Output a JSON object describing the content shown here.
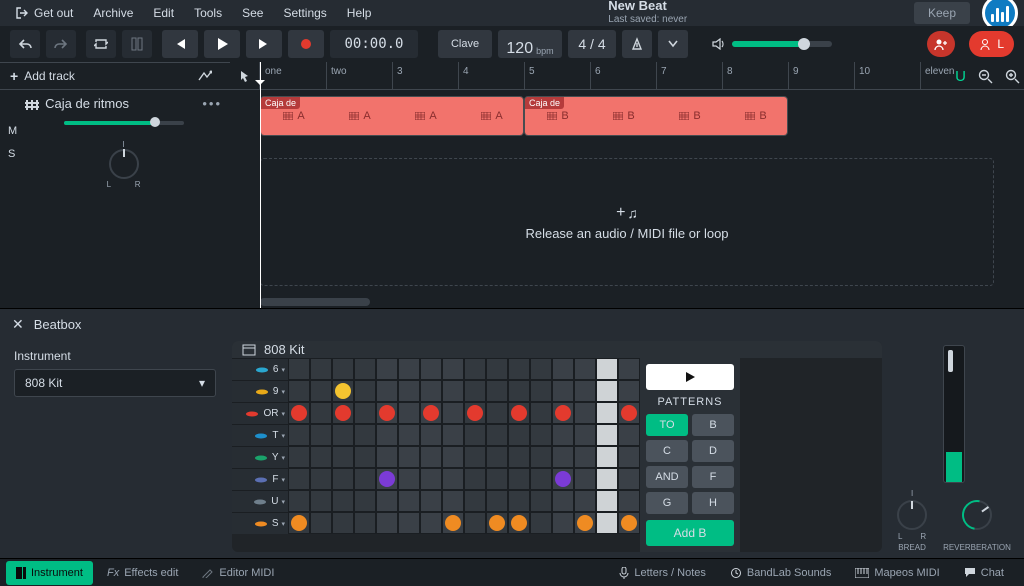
{
  "menu": {
    "getout": "Get out",
    "items": [
      "Archive",
      "Edit",
      "Tools",
      "See",
      "Settings",
      "Help"
    ],
    "keep": "Keep"
  },
  "title": {
    "name": "New Beat",
    "saved": "Last saved: never"
  },
  "transport": {
    "time": "00:00.0",
    "clave": "Clave",
    "bpm": "120",
    "bpm_unit": "bpm",
    "timesig": "4 / 4"
  },
  "collab": {
    "label": "L"
  },
  "sidebar": {
    "add": "Add track"
  },
  "track": {
    "name": "Caja de ritmos",
    "mute": "M",
    "solo": "S",
    "pan_i": "I",
    "pan_l": "L",
    "pan_r": "R"
  },
  "ruler": [
    "one",
    "two",
    "3",
    "4",
    "5",
    "6",
    "7",
    "8",
    "9",
    "10",
    "eleven"
  ],
  "clipA": {
    "tag": "Caja de",
    "segs": [
      "A",
      "A",
      "A",
      "A"
    ]
  },
  "clipB": {
    "tag": "Caja de",
    "segs": [
      "B",
      "B",
      "B",
      "B"
    ]
  },
  "drop": "Release an audio / MIDI file or loop",
  "zoom": {
    "magnet": "U"
  },
  "beatbox": {
    "title": "Beatbox",
    "instrument_label": "Instrument",
    "instrument": "808 Kit",
    "kit": "808 Kit",
    "rows": [
      {
        "id": "6",
        "color": "#2aa7d0",
        "steps": []
      },
      {
        "id": "9",
        "color": "#e8a918",
        "steps": [
          {
            "i": 2,
            "c": "#f4c430"
          }
        ]
      },
      {
        "id": "OR",
        "color": "#e33a2e",
        "steps": [
          {
            "i": 0,
            "c": "#e33a2e"
          },
          {
            "i": 2,
            "c": "#e33a2e"
          },
          {
            "i": 4,
            "c": "#e33a2e"
          },
          {
            "i": 6,
            "c": "#e33a2e"
          },
          {
            "i": 8,
            "c": "#e33a2e"
          },
          {
            "i": 10,
            "c": "#e33a2e"
          },
          {
            "i": 12,
            "c": "#e33a2e"
          },
          {
            "i": 15,
            "c": "#e33a2e"
          }
        ]
      },
      {
        "id": "T",
        "color": "#1d8fcc",
        "steps": []
      },
      {
        "id": "Y",
        "color": "#1aa36b",
        "steps": []
      },
      {
        "id": "F",
        "color": "#5b6fb3",
        "steps": [
          {
            "i": 4,
            "c": "#7b3bd6"
          },
          {
            "i": 12,
            "c": "#7b3bd6"
          }
        ]
      },
      {
        "id": "U",
        "color": "#6f7f8c",
        "steps": []
      },
      {
        "id": "S",
        "color": "#ef8b22",
        "steps": [
          {
            "i": 0,
            "c": "#ef8b22"
          },
          {
            "i": 7,
            "c": "#ef8b22"
          },
          {
            "i": 9,
            "c": "#ef8b22"
          },
          {
            "i": 10,
            "c": "#ef8b22"
          },
          {
            "i": 13,
            "c": "#ef8b22"
          },
          {
            "i": 15,
            "c": "#ef8b22"
          }
        ]
      }
    ],
    "patterns_title": "PATTERNS",
    "patterns": [
      "TO",
      "B",
      "C",
      "D",
      "AND",
      "F",
      "G",
      "H"
    ],
    "pattern_active": 0,
    "add_label": "Add B",
    "knobs": {
      "bread": "BREAD",
      "reverb": "REVERBERATION",
      "l": "L",
      "r": "R",
      "i": "I"
    }
  },
  "footer": {
    "instrument": "Instrument",
    "fx": "Effects edit",
    "fx_pre": "Fx",
    "editor": "Editor MIDI",
    "letters": "Letters / Notes",
    "sounds": "BandLab Sounds",
    "midi": "Mapeos MIDI",
    "chat": "Chat"
  }
}
